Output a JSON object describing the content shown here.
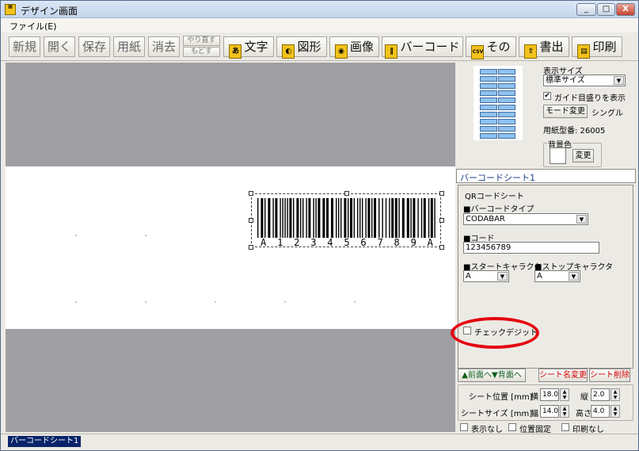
{
  "window": {
    "title": "デザイン画面",
    "minimize": "_",
    "maximize": "□",
    "close": "X"
  },
  "menu": {
    "file": "ファイル(E)"
  },
  "toolbar": {
    "new": "新規",
    "open": "開く",
    "save": "保存",
    "paper": "用紙",
    "erase": "消去",
    "redo": "やり直す",
    "undo": "もどす",
    "text": "文字",
    "shape": "図形",
    "image": "画像",
    "barcode": "バーコード",
    "other": "その他",
    "export": "書出",
    "print": "印刷",
    "icon_text": "あ",
    "icon_csv": "CSV"
  },
  "barcode": {
    "human_readable": [
      "A",
      "1",
      "2",
      "3",
      "4",
      "5",
      "6",
      "7",
      "8",
      "9",
      "A"
    ]
  },
  "side": {
    "display_size_label": "表示サイズ",
    "display_size_value": "標準サイズ",
    "guide_label": "ガイド目盛りを表示",
    "guide_checked": true,
    "mode_button": "モード変更",
    "mode_value": "シングル",
    "paper_number": "用紙型番: 26005",
    "bg_label": "背景色",
    "bg_button": "変更"
  },
  "sheet": {
    "tab_label": "バーコードシート1",
    "sheet_type": "QRコードシート",
    "barcode_type_label": "■バーコードタイプ",
    "barcode_type_value": "CODABAR",
    "code_label": "■コード",
    "code_value": "123456789",
    "start_char_label": "■スタートキャラクタ",
    "start_char_value": "A",
    "stop_char_label": "■ストップキャラクタ",
    "stop_char_value": "A",
    "check_digit_label": "チェックデジット",
    "check_digit_checked": false
  },
  "sheet_actions": {
    "front": "▲前面へ",
    "back": "▼背面へ",
    "rename": "シート名変更",
    "delete": "シート削除"
  },
  "geometry": {
    "pos_label": "シート位置 [mm]",
    "size_label": "シートサイズ [mm]",
    "x_label": "横",
    "x_value": "18.0",
    "y_label": "縦",
    "y_value": "2.0",
    "w_label": "幅",
    "w_value": "14.0",
    "h_label": "高さ",
    "h_value": "4.0"
  },
  "options": {
    "hide": "表示なし",
    "lock": "位置固定",
    "noprint": "印刷なし"
  },
  "status": {
    "sheet_tab": "バーコードシート1"
  }
}
